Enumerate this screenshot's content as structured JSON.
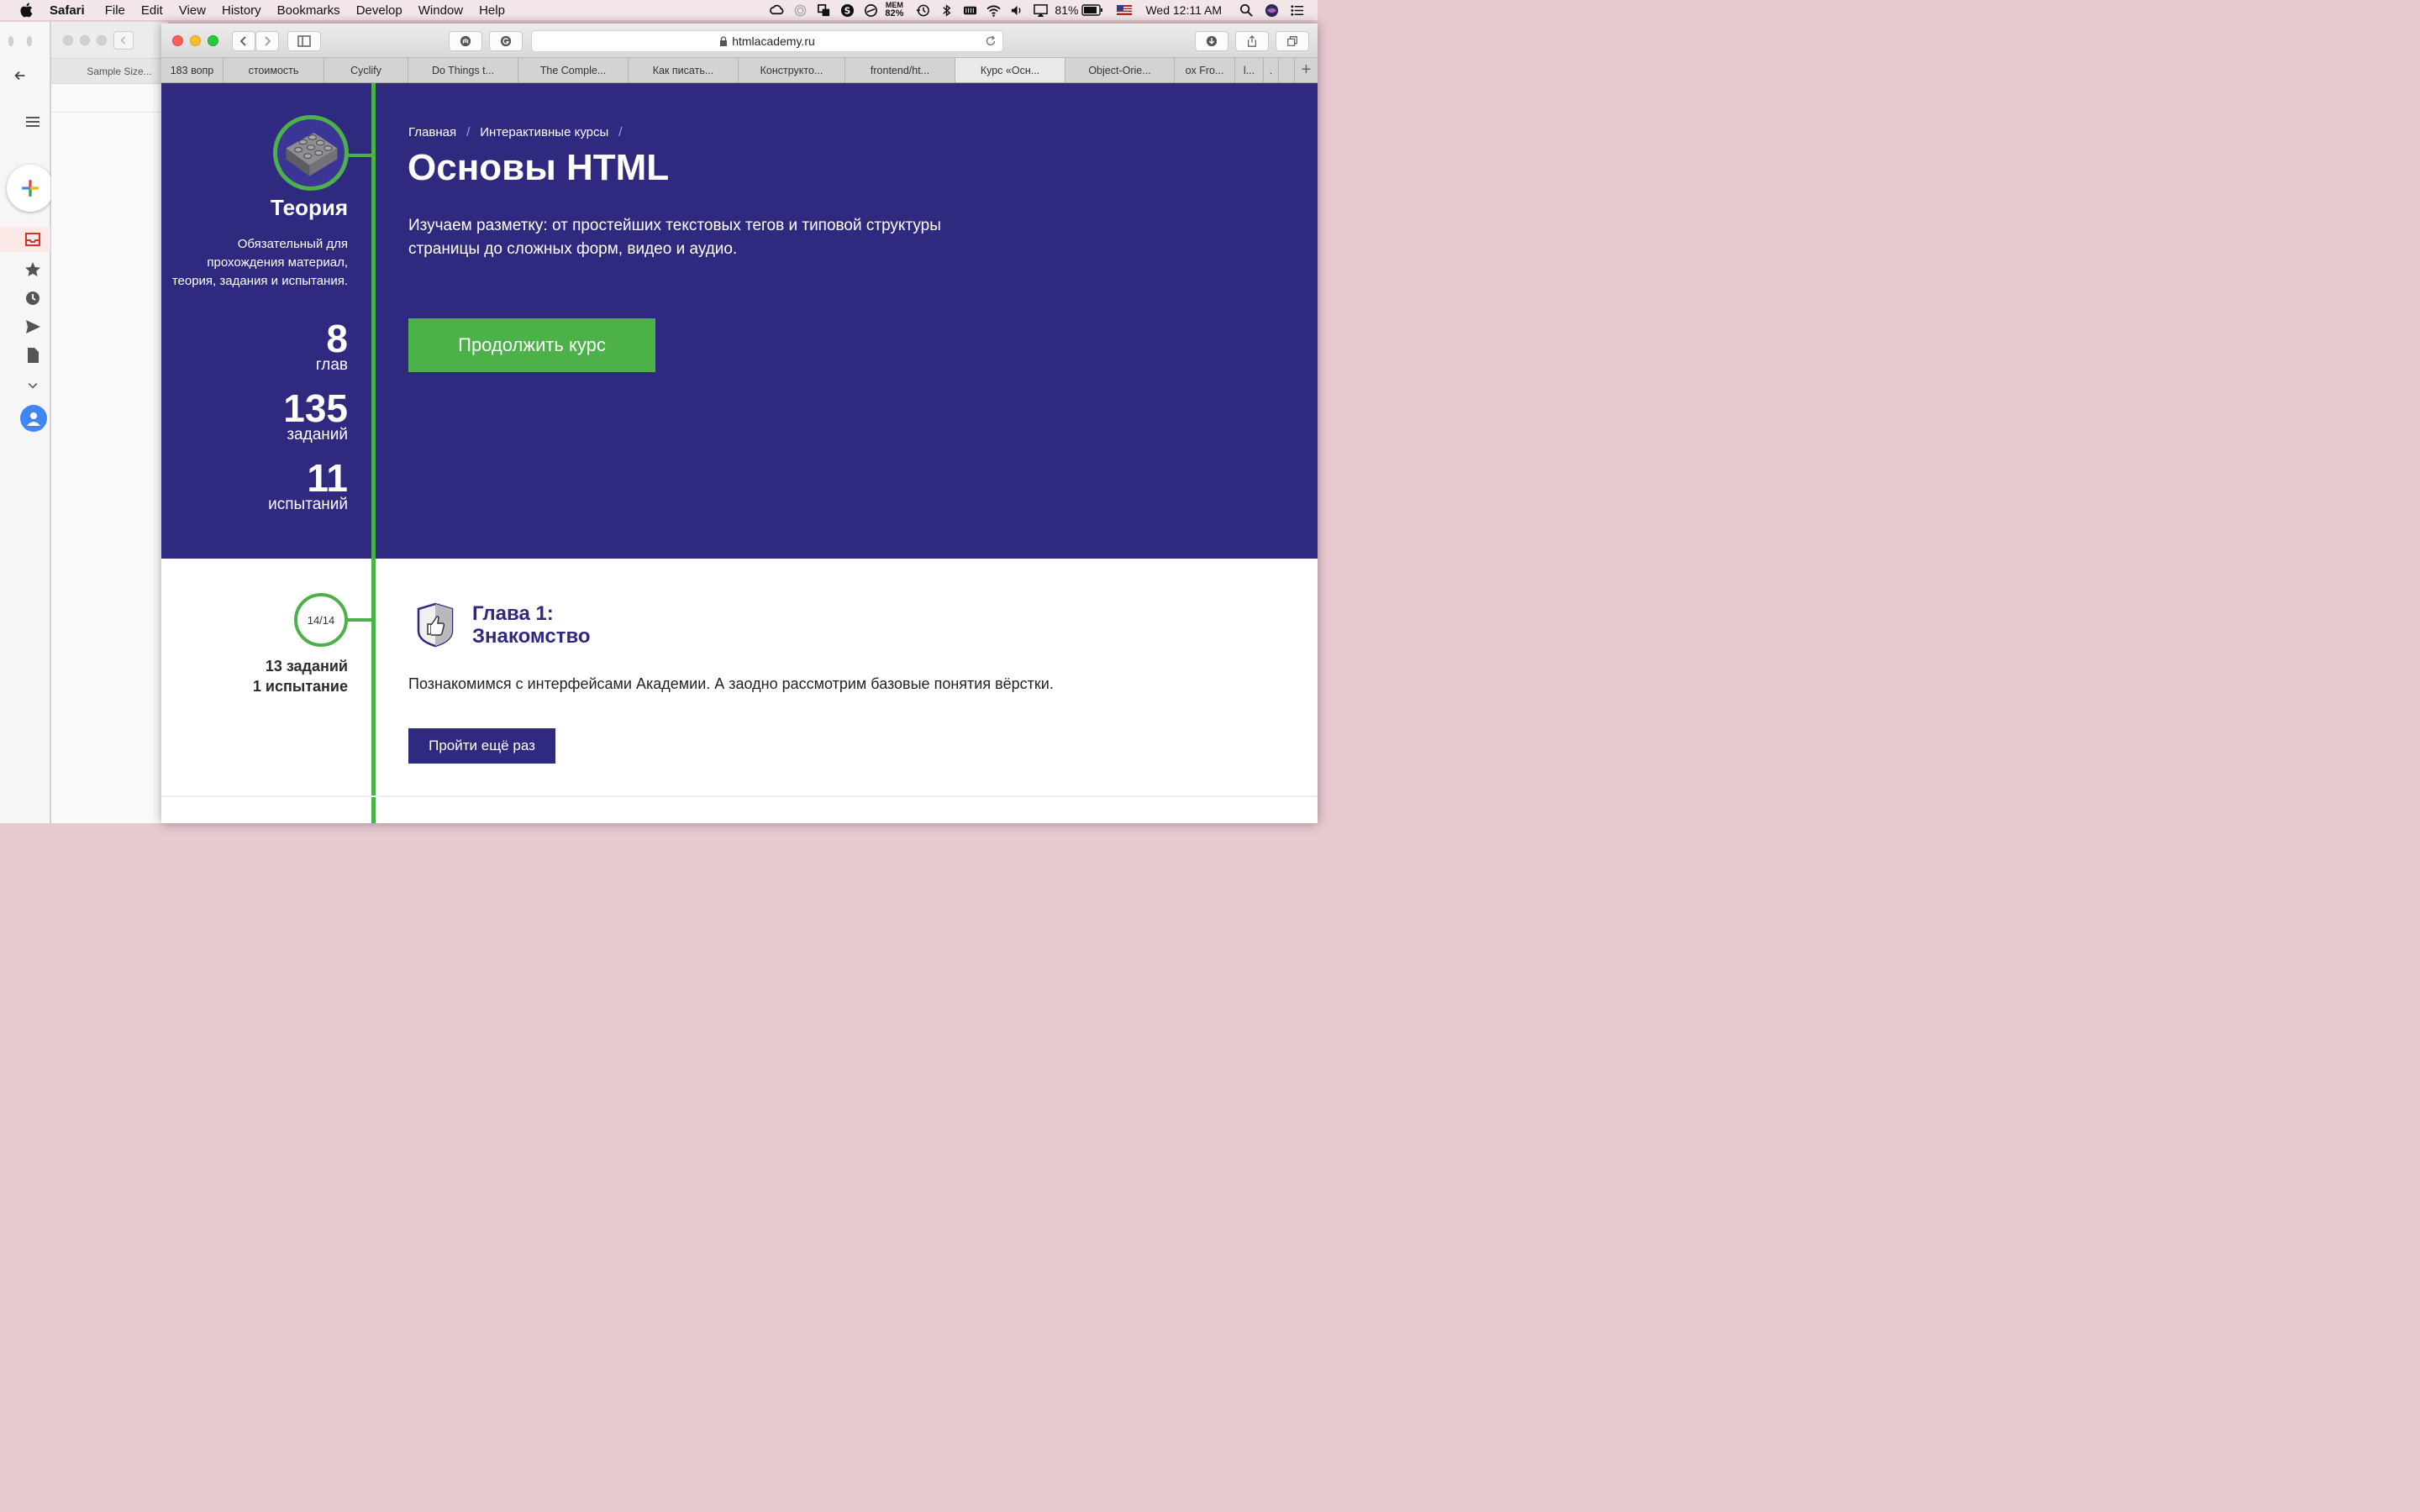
{
  "menubar": {
    "app": "Safari",
    "items": [
      "File",
      "Edit",
      "View",
      "History",
      "Bookmarks",
      "Develop",
      "Window",
      "Help"
    ],
    "mem_label": "MEM",
    "mem_value": "82%",
    "battery": "81%",
    "clock": "Wed 12:11 AM"
  },
  "bg_window": {
    "tab_title": "Sample Size..."
  },
  "safari": {
    "url": "htmlacademy.ru",
    "tabs": [
      {
        "label": "183 вопр",
        "active": false
      },
      {
        "label": "стоимость",
        "active": false
      },
      {
        "label": "Cyclify",
        "active": false
      },
      {
        "label": "Do Things t...",
        "active": false
      },
      {
        "label": "The Comple...",
        "active": false
      },
      {
        "label": "Как писать...",
        "active": false
      },
      {
        "label": "Конструкто...",
        "active": false
      },
      {
        "label": "frontend/ht...",
        "active": false
      },
      {
        "label": "Курс «Осн...",
        "active": true
      },
      {
        "label": "Object-Orie...",
        "active": false
      },
      {
        "label": "ox Fro...",
        "active": false
      },
      {
        "label": "l...",
        "active": false
      },
      {
        "label": ".",
        "active": false
      }
    ],
    "new_tab": "+"
  },
  "page": {
    "breadcrumb": {
      "home": "Главная",
      "sep": "/",
      "section": "Интерактивные курсы",
      "sep2": "/"
    },
    "title": "Основы HTML",
    "description": "Изучаем разметку: от простейших текстовых тегов и типовой структуры страницы до сложных форм, видео и аудио.",
    "continue_label": "Продолжить курс",
    "theory": {
      "title": "Теория",
      "description": "Обязательный для прохождения материал, теория, задания и испытания.",
      "stats": [
        {
          "value": "8",
          "label": "глав"
        },
        {
          "value": "135",
          "label": "заданий"
        },
        {
          "value": "11",
          "label": "испытаний"
        }
      ]
    },
    "chapter": {
      "progress": "14/14",
      "tasks": "13 заданий",
      "trials": "1 испытание",
      "title_line1": "Глава 1:",
      "title_line2": "Знакомство",
      "description": "Познакомимся с интерфейсами Академии. А заодно рассмотрим базовые понятия вёрстки.",
      "again_label": "Пройти ещё раз"
    }
  },
  "colors": {
    "hero_bg": "#2f2a80",
    "accent_green": "#4db14a",
    "chapter_title": "#2f2a80"
  }
}
